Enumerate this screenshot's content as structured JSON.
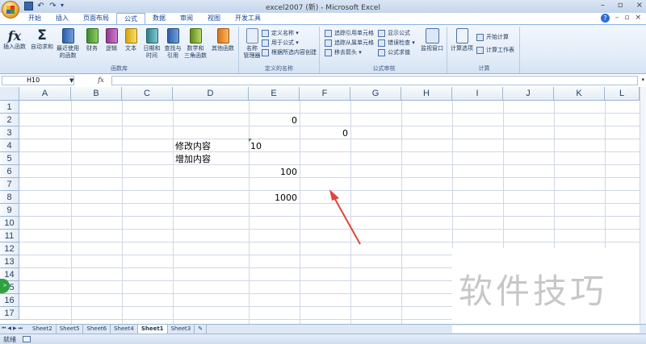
{
  "window": {
    "title": "excel2007 (新) - Microsoft Excel",
    "controls": [
      "–",
      "▫",
      "×"
    ]
  },
  "quick_access": {
    "undo": "↶",
    "redo": "↷",
    "more": "▾"
  },
  "ribbon_tabs": [
    "开始",
    "插入",
    "页面布局",
    "公式",
    "数据",
    "审阅",
    "视图",
    "开发工具"
  ],
  "active_tab": "公式",
  "help": {
    "question": "?",
    "minimize": "–",
    "restore": "▫",
    "close": "×"
  },
  "ribbon": {
    "function_library": {
      "label": "函数库",
      "buttons": [
        {
          "label": "插入函数",
          "icon": "fx-icon"
        },
        {
          "label": "自动求和",
          "icon": "sigma-icon"
        },
        {
          "label": "最近使用的函数",
          "line1": "最近使用",
          "line2": "的函数",
          "icon": "book-blue-icon"
        },
        {
          "label": "财务",
          "icon": "book-green-icon"
        },
        {
          "label": "逻辑",
          "icon": "book-purple-icon"
        },
        {
          "label": "文本",
          "icon": "book-yellow-icon"
        },
        {
          "label": "日期和时间",
          "line1": "日期和",
          "line2": "时间",
          "icon": "book-teal-icon"
        },
        {
          "label": "查找与引用",
          "line1": "查找与",
          "line2": "引用",
          "icon": "book-blue-icon"
        },
        {
          "label": "数学和三角函数",
          "line1": "数学和",
          "line2": "三角函数",
          "icon": "book-olive-icon"
        },
        {
          "label": "其他函数",
          "icon": "book-orange-icon"
        }
      ]
    },
    "defined_names": {
      "label": "定义的名称",
      "manager": {
        "line1": "名称",
        "line2": "管理器"
      },
      "items": [
        "定义名称 ▾",
        "用于公式 ▾",
        "根据所选内容创建"
      ]
    },
    "formula_auditing": {
      "label": "公式审核",
      "items": [
        "追踪引用单元格",
        "追踪从属单元格",
        "移去箭头 ▾"
      ],
      "items_right": [
        "显示公式",
        "错误检查 ▾",
        "公式求值"
      ],
      "watch": "监视窗口"
    },
    "calculation": {
      "label": "计算",
      "options": "计算选项",
      "items": [
        "开始计算",
        "计算工作表"
      ]
    }
  },
  "formula_bar": {
    "name_box": "H10",
    "fx": "fx",
    "value": ""
  },
  "columns": [
    "A",
    "B",
    "C",
    "D",
    "E",
    "F",
    "G",
    "H",
    "I",
    "J",
    "K",
    "L"
  ],
  "rows": [
    "1",
    "2",
    "3",
    "4",
    "5",
    "6",
    "7",
    "8",
    "9",
    "10",
    "11",
    "12",
    "13",
    "14",
    "15",
    "16",
    "17"
  ],
  "cells": {
    "E2": "0",
    "F3": "0",
    "D4": "修改内容",
    "E4": "10",
    "D5": "增加内容",
    "E6": "100",
    "E8": "1000"
  },
  "annotation_arrow_color": "#e0453a",
  "watermark": "软件技巧",
  "sheet_nav": [
    "⏮",
    "◀",
    "▶",
    "⏭"
  ],
  "sheets": [
    "Sheet2",
    "Sheet5",
    "Sheet6",
    "Sheet4",
    "Sheet1",
    "Sheet3"
  ],
  "active_sheet": "Sheet1",
  "status": {
    "text": "就绪"
  }
}
